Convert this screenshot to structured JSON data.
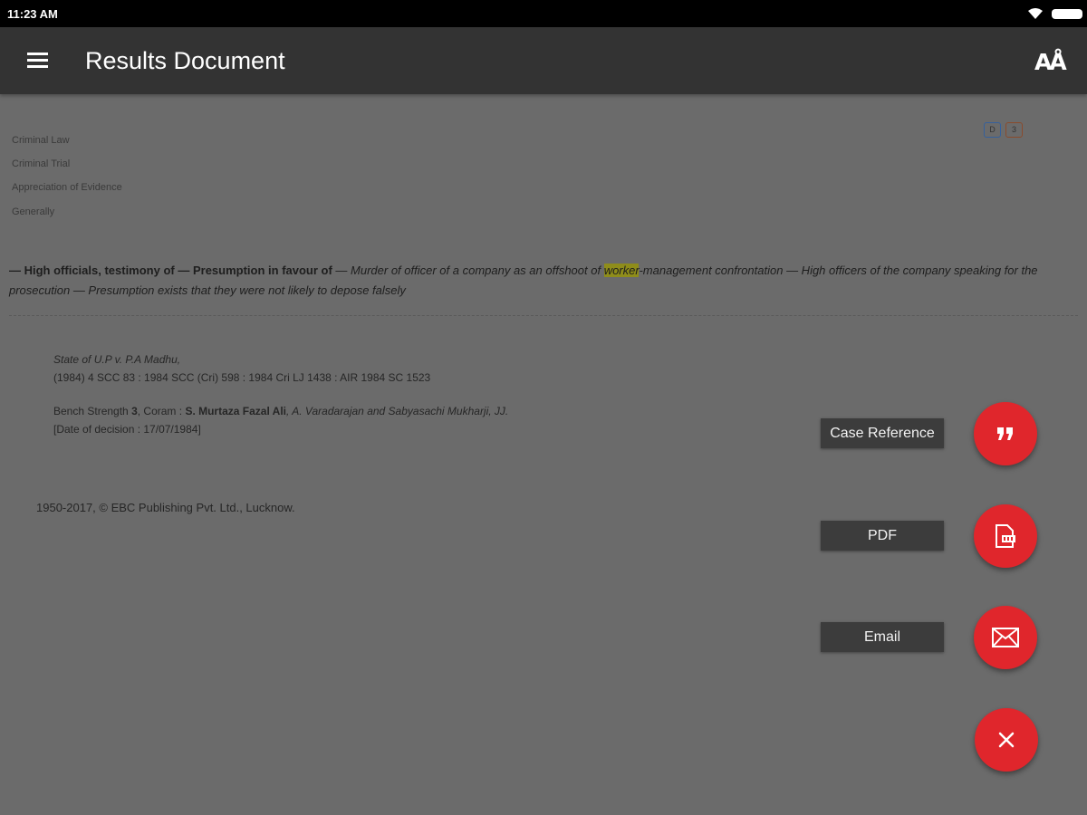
{
  "status_bar": {
    "time": "11:23 AM",
    "wifi_icon": "wifi-icon",
    "battery_icon": "battery-icon"
  },
  "app_bar": {
    "title": "Results Document",
    "menu_icon": "menu-icon",
    "text_size_label": "AÅ"
  },
  "document": {
    "topics": [
      "Criminal Law",
      "Criminal Trial",
      "Appreciation of Evidence",
      "Generally"
    ],
    "badges": [
      "D",
      "3"
    ],
    "headnote": {
      "bold_part": "— High officials, testimony of — Presumption in favour of",
      "italic_before": " — Murder of officer of a company as an offshoot of ",
      "highlight": "worker",
      "italic_after": "-management confrontation — High officers of the company speaking for the prosecution — Presumption exists that they were not likely to depose falsely"
    },
    "citation": {
      "case_name": "State of U.P v. P.A Madhu,",
      "reporters": "(1984) 4 SCC 83 : 1984 SCC (Cri) 598 : 1984 Cri LJ 1438 : AIR 1984 SC 1523",
      "bench_prefix": "Bench Strength ",
      "bench_strength": "3",
      "coram_prefix": ", Coram : ",
      "coram_bold": "S. Murtaza Fazal Ali",
      "coram_rest": ", A. Varadarajan and Sabyasachi Mukharji, JJ.",
      "date": "[Date of decision : 17/07/1984]"
    },
    "copyright": "1950-2017, © EBC Publishing Pvt. Ltd., Lucknow."
  },
  "speed_dial": {
    "actions": [
      {
        "label": "Case Reference",
        "icon": "quote-icon"
      },
      {
        "label": "PDF",
        "icon": "pdf-icon"
      },
      {
        "label": "Email",
        "icon": "email-icon"
      }
    ],
    "close_icon": "close-icon",
    "accent_color": "#e0262c",
    "label_bg_color": "#3c3c3c"
  },
  "colors": {
    "status_bar": "#000000",
    "app_bar": "#333333",
    "scrim_background": "#6b6b6b",
    "highlight": "#8f8d1a"
  }
}
